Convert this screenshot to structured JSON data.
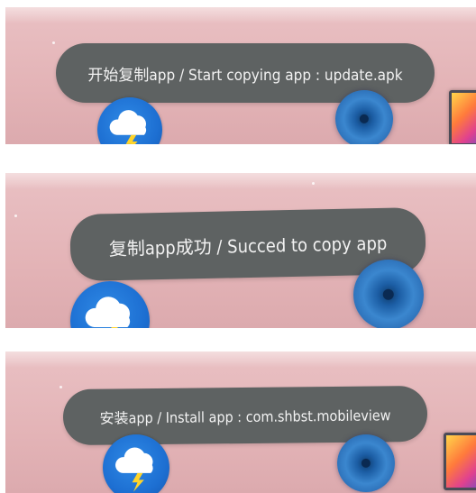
{
  "frames": [
    {
      "toast_text": "开始复制app / Start copying app : update.apk"
    },
    {
      "toast_text": "复制app成功 / Succed to copy app"
    },
    {
      "toast_text": "安装app / Install app : com.shbst.mobileview"
    }
  ],
  "icons": {
    "weather": "weather-cloud-lightning-icon",
    "speaker": "speaker-icon",
    "gallery": "gallery-icon"
  },
  "colors": {
    "wallpaper": "#e3b3b6",
    "toast_background": "#5e6262",
    "toast_text": "#f2f2f2",
    "weather_icon": "#1d6fd2",
    "speaker_icon": "#2a6cb4"
  }
}
